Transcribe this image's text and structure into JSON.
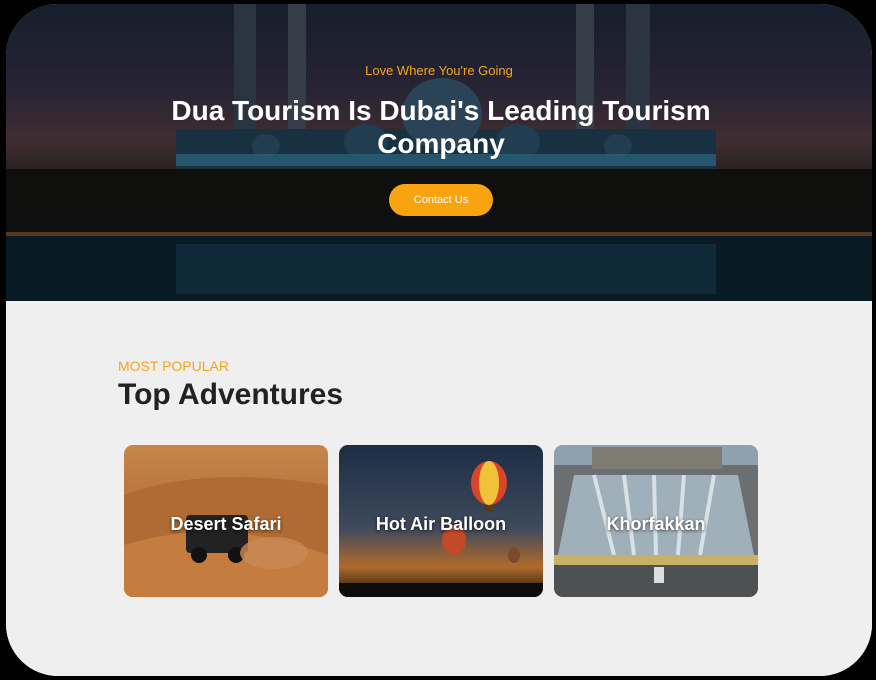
{
  "hero": {
    "tagline": "Love Where You're Going",
    "title": "Dua Tourism Is Dubai's Leading Tourism Company",
    "cta_label": "Contact Us"
  },
  "adventures": {
    "eyebrow": "MOST POPULAR",
    "heading": "Top Adventures",
    "cards": [
      {
        "label": "Desert Safari"
      },
      {
        "label": "Hot Air Balloon"
      },
      {
        "label": "Khorfakkan"
      }
    ]
  },
  "colors": {
    "accent": "#f5a51a",
    "button": "#f7a410",
    "section_bg": "#efefef",
    "heading": "#222222"
  }
}
